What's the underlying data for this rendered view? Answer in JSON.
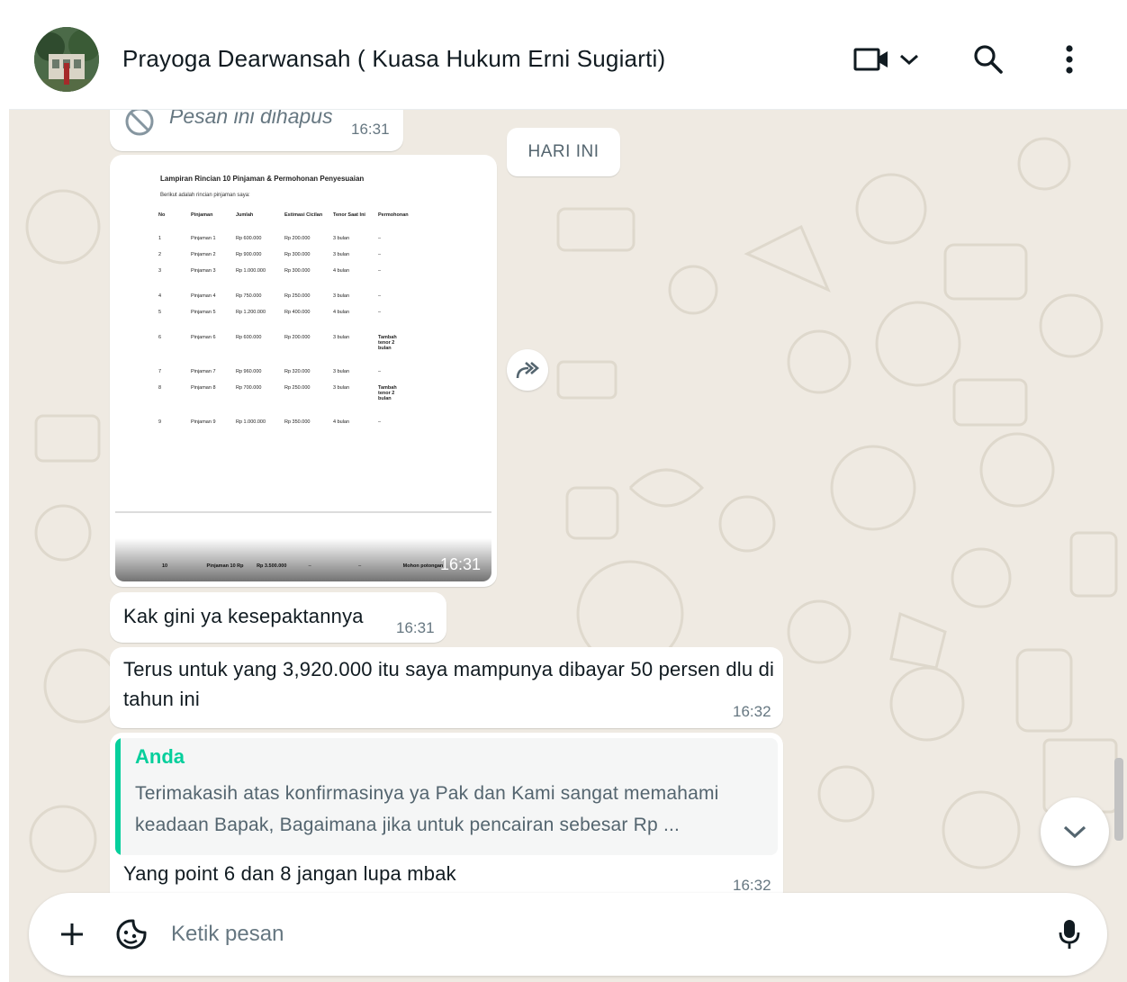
{
  "header": {
    "contact_name": "Prayoga Dearwansah ( Kuasa Hukum Erni Sugiarti)",
    "icons": [
      "video-call-icon",
      "chevron-down-icon",
      "search-icon",
      "menu-kebab-icon"
    ]
  },
  "chat": {
    "date_chip": "HARI INI",
    "deleted": {
      "text": "Pesan ini dihapus",
      "time": "16:31"
    },
    "image": {
      "time": "16:31",
      "doc_title": "Lampiran Rincian 10 Pinjaman & Permohonan Penyesuaian",
      "doc_subtitle": "Berikut adalah rincian pinjaman saya:",
      "columns": [
        "No",
        "Pinjaman",
        "Jumlah",
        "Estimasi Cicilan",
        "Tenor Saat Ini",
        "Permohonan"
      ],
      "rows": [
        [
          "1",
          "Pinjaman 1",
          "Rp 600.000",
          "Rp 200.000",
          "3 bulan",
          "–"
        ],
        [
          "2",
          "Pinjaman 2",
          "Rp 900.000",
          "Rp 300.000",
          "3 bulan",
          "–"
        ],
        [
          "3",
          "Pinjaman 3",
          "Rp 1.000.000",
          "Rp 300.000",
          "4 bulan",
          "–"
        ],
        [
          "4",
          "Pinjaman 4",
          "Rp 750.000",
          "Rp 250.000",
          "3 bulan",
          "–"
        ],
        [
          "5",
          "Pinjaman 5",
          "Rp 1.200.000",
          "Rp 400.000",
          "4 bulan",
          "–"
        ],
        [
          "6",
          "Pinjaman 6",
          "Rp 600.000",
          "Rp 200.000",
          "3 bulan",
          "Tambah tenor 2 bulan"
        ],
        [
          "7",
          "Pinjaman 7",
          "Rp 960.000",
          "Rp 320.000",
          "3 bulan",
          "–"
        ],
        [
          "8",
          "Pinjaman 8",
          "Rp 700.000",
          "Rp 250.000",
          "3 bulan",
          "Tambah tenor 2 bulan"
        ],
        [
          "9",
          "Pinjaman 9",
          "Rp 1.000.000",
          "Rp 350.000",
          "4 bulan",
          "–"
        ]
      ],
      "footer_row": [
        "10",
        "Pinjaman 10 Rp",
        "Rp 3.500.000",
        "–",
        "–",
        "Mohon potongan"
      ]
    },
    "messages": [
      {
        "text": "Kak gini ya kesepaktannya",
        "time": "16:31"
      },
      {
        "text": "Terus untuk yang 3,920.000 itu saya mampunya dibayar 50 persen dlu di tahun ini",
        "time": "16:32"
      },
      {
        "quote_author": "Anda",
        "quote_text": "Terimakasih atas konfirmasinya ya Pak dan Kami sangat memahami keadaan Bapak, Bagaimana jika untuk pencairan sebesar Rp ...",
        "text": "Yang point 6 dan 8 jangan lupa mbak",
        "time": "16:32"
      }
    ]
  },
  "composer": {
    "placeholder": "Ketik pesan"
  },
  "colors": {
    "accent": "#06cf9c",
    "chat_bg": "#efeae2",
    "bubble": "#ffffff"
  }
}
